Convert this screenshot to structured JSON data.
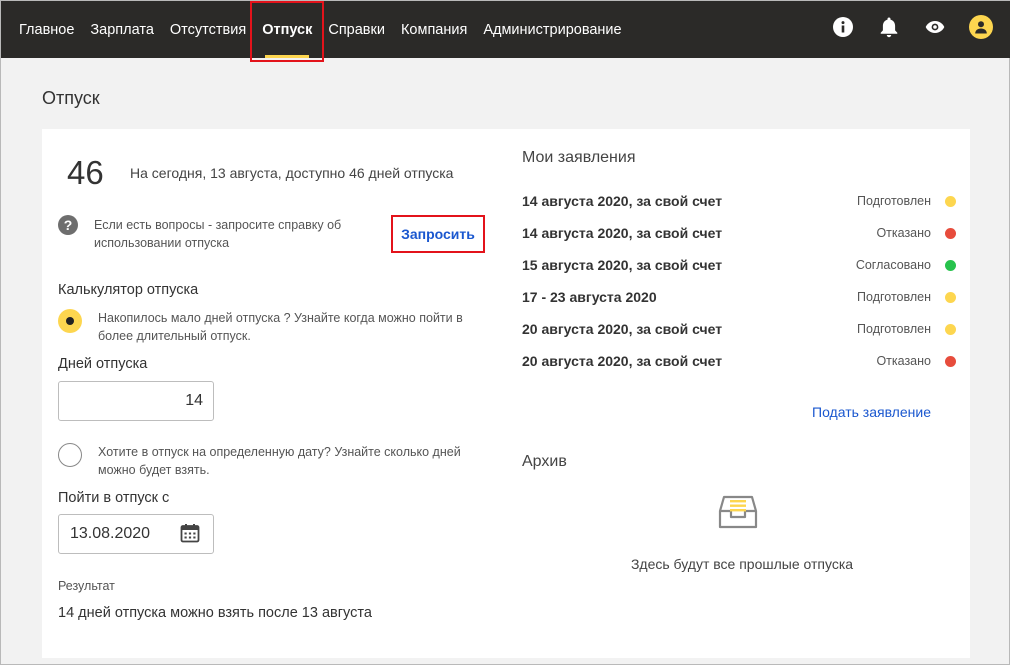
{
  "nav": {
    "items": [
      {
        "label": "Главное",
        "active": false
      },
      {
        "label": "Зарплата",
        "active": false
      },
      {
        "label": "Отсутствия",
        "active": false
      },
      {
        "label": "Отпуск",
        "active": true
      },
      {
        "label": "Справки",
        "active": false
      },
      {
        "label": "Компания",
        "active": false
      },
      {
        "label": "Администрирование",
        "active": false
      }
    ],
    "icons": [
      "info-icon",
      "bell-icon",
      "eye-icon",
      "user-avatar-icon"
    ]
  },
  "page": {
    "title": "Отпуск"
  },
  "balance": {
    "days": "46",
    "text": "На сегодня, 13 августа, доступно 46 дней отпуска"
  },
  "help": {
    "text": "Если есть вопросы - запросите справку об использовании отпуска",
    "button_label": "Запросить"
  },
  "calculator": {
    "title": "Калькулятор отпуска",
    "option1_text": "Накопилось мало дней отпуска ? Узнайте когда можно пойти в более длительный отпуск.",
    "days_label": "Дней отпуска",
    "days_value": "14",
    "option2_text": "Хотите в отпуск на определенную дату? Узнайте сколько дней можно будет взять.",
    "date_label": "Пойти в отпуск с",
    "date_value": "13.08.2020",
    "result_label": "Результат",
    "result_text": "14 дней отпуска можно взять после 13 августа"
  },
  "applications": {
    "title": "Мои заявления",
    "items": [
      {
        "name": "14 августа 2020, за свой счет",
        "status": "Подготовлен",
        "color": "#fdd64f"
      },
      {
        "name": "14 августа 2020, за свой счет",
        "status": "Отказано",
        "color": "#e74c3c"
      },
      {
        "name": "15 августа 2020, за свой счет",
        "status": "Согласовано",
        "color": "#27c24c"
      },
      {
        "name": "17 - 23 августа 2020",
        "status": "Подготовлен",
        "color": "#fdd64f"
      },
      {
        "name": "20 августа 2020, за свой счет",
        "status": "Подготовлен",
        "color": "#fdd64f"
      },
      {
        "name": "20 августа 2020, за свой счет",
        "status": "Отказано",
        "color": "#e74c3c"
      }
    ],
    "submit_label": "Подать заявление"
  },
  "archive": {
    "title": "Архив",
    "empty_text": "Здесь будут все прошлые отпуска"
  },
  "colors": {
    "topbar": "#2b2a28",
    "accent": "#fdd64f",
    "link": "#1a57cf",
    "highlight": "#e3131b"
  }
}
